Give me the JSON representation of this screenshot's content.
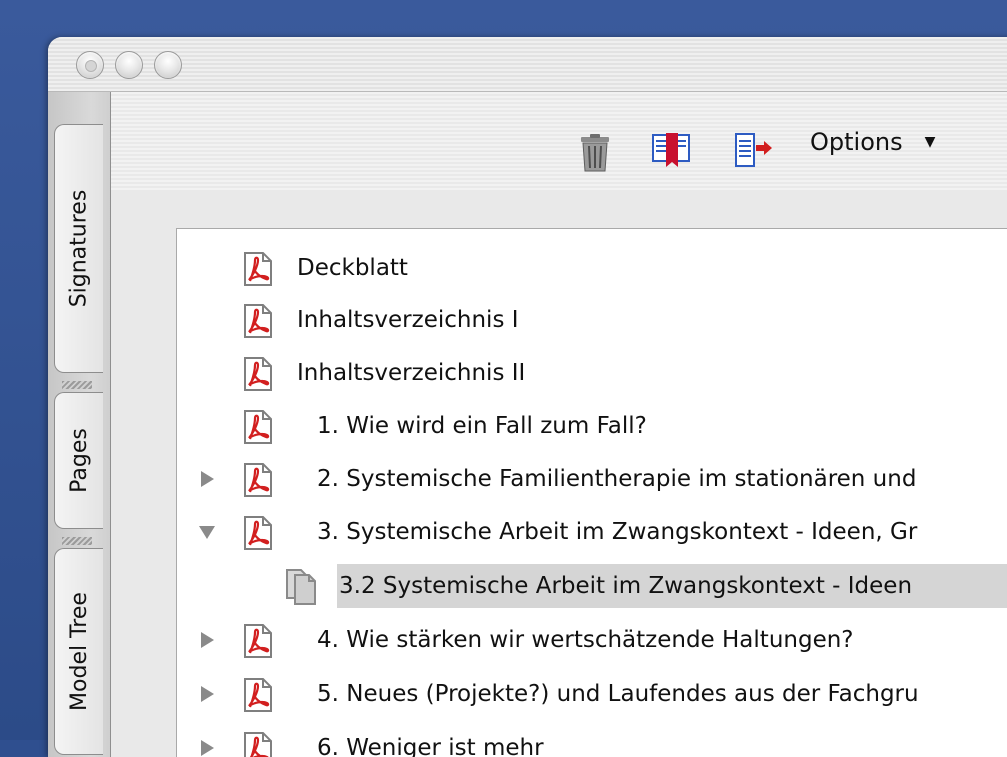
{
  "sidebar": {
    "tabs": [
      {
        "label": "Signatures"
      },
      {
        "label": "Pages"
      },
      {
        "label": "Model Tree"
      }
    ]
  },
  "toolbar": {
    "icons": [
      "trash-icon",
      "expand-bookmark-icon",
      "bookmark-go-icon"
    ],
    "options_label": "Options"
  },
  "bookmarks": [
    {
      "label": "Deckblatt",
      "indent": 0,
      "state": "leaf"
    },
    {
      "label": "Inhaltsverzeichnis I",
      "indent": 0,
      "state": "leaf"
    },
    {
      "label": "Inhaltsverzeichnis II",
      "indent": 0,
      "state": "leaf"
    },
    {
      "label": "1. Wie wird ein Fall zum Fall?",
      "indent": 0,
      "state": "leaf"
    },
    {
      "label": "2. Systemische Familientherapie im stationären und",
      "indent": 0,
      "state": "collapsed"
    },
    {
      "label": "3. Systemische Arbeit im Zwangskontext - Ideen, Gr",
      "indent": 0,
      "state": "expanded"
    },
    {
      "label": "3.2 Systemische Arbeit im Zwangskontext - Ideen",
      "indent": 1,
      "state": "selected"
    },
    {
      "label": "4. Wie stärken wir wertschätzende Haltungen?",
      "indent": 0,
      "state": "collapsed"
    },
    {
      "label": "5. Neues (Projekte?) und Laufendes aus der Fachgru",
      "indent": 0,
      "state": "collapsed"
    },
    {
      "label": "6. Weniger ist mehr",
      "indent": 0,
      "state": "collapsed"
    }
  ],
  "colors": {
    "desktop": "#2f4f8f",
    "pdf_red": "#d21f1f",
    "selection": "#d5d5d5"
  }
}
